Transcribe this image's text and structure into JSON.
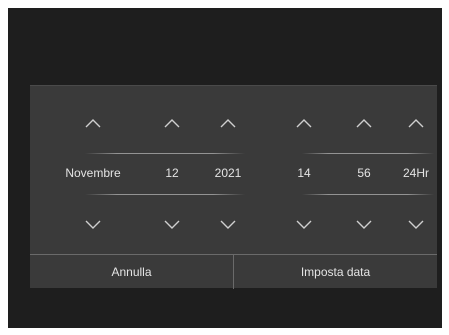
{
  "columns": [
    {
      "id": "month",
      "value": "Novembre"
    },
    {
      "id": "day",
      "value": "12"
    },
    {
      "id": "year",
      "value": "2021"
    },
    {
      "id": "hour",
      "value": "14"
    },
    {
      "id": "minute",
      "value": "56"
    },
    {
      "id": "format",
      "value": "24Hr"
    }
  ],
  "buttons": {
    "cancel": "Annulla",
    "set_date": "Imposta data"
  },
  "icons": {
    "up": "chevron-up-icon",
    "down": "chevron-down-icon"
  },
  "colors": {
    "screen_bg": "#1e1e1e",
    "dialog_bg": "#3a3a3a",
    "text": "#e4e4e4"
  }
}
